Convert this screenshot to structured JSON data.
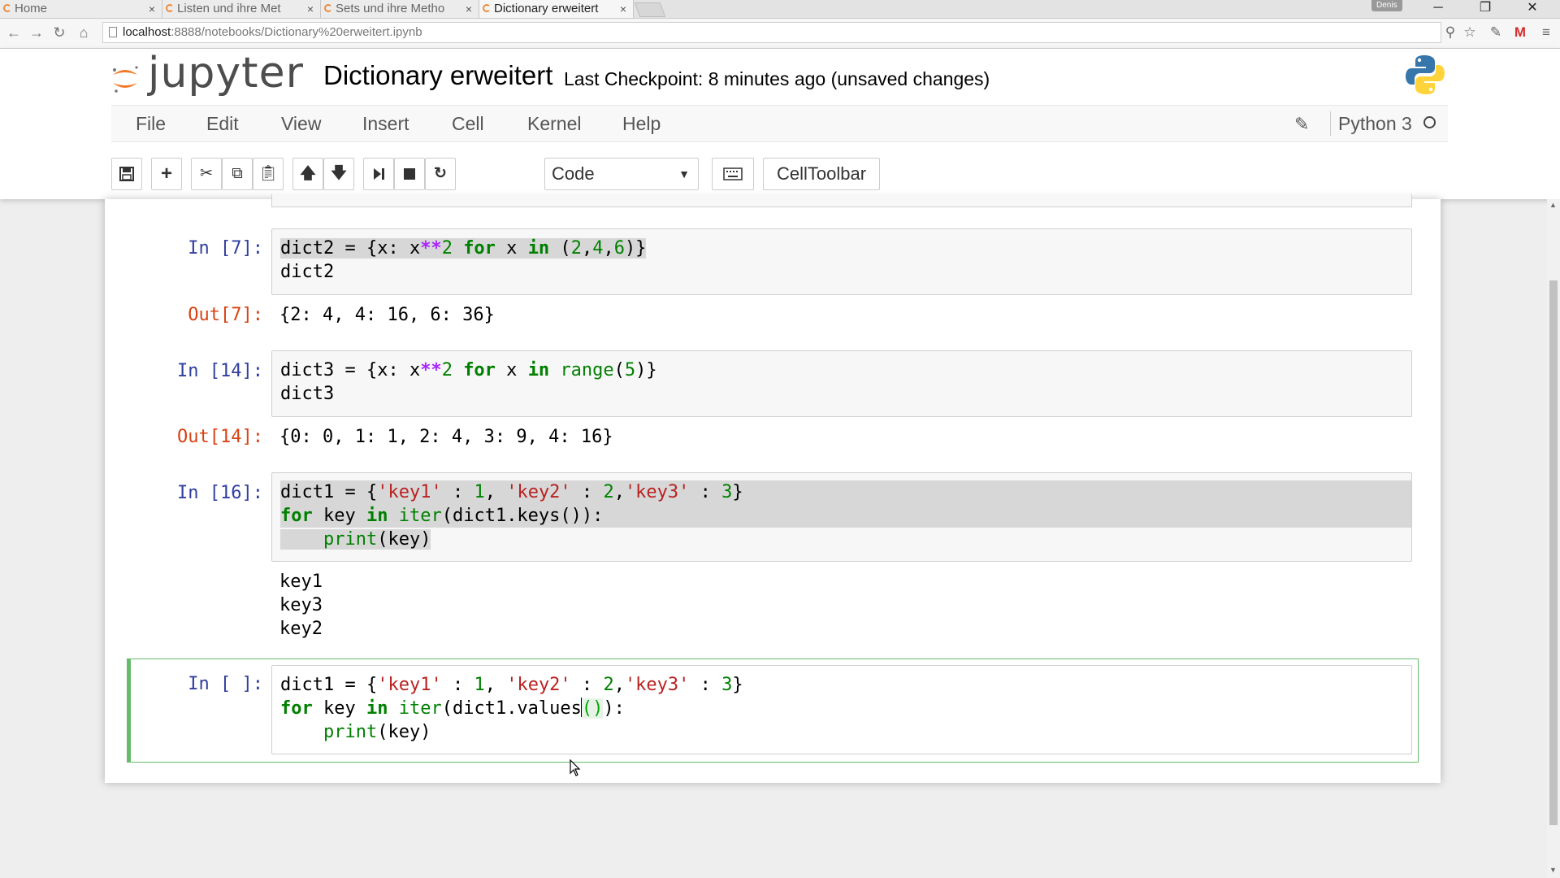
{
  "browser": {
    "tabs": [
      {
        "label": "Home",
        "close": "×"
      },
      {
        "label": "Listen und ihre Met",
        "close": "×"
      },
      {
        "label": "Sets und ihre Metho",
        "close": "×"
      },
      {
        "label": "Dictionary erweitert",
        "close": "×"
      }
    ],
    "user_badge": "Denis",
    "window_controls": {
      "minimize": "─",
      "restore": "❐",
      "close": "✕"
    },
    "url_host": "localhost",
    "url_path": ":8888/notebooks/Dictionary%20erweitert.ipynb"
  },
  "jupyter": {
    "logo_text": "jupyter",
    "notebook_title": "Dictionary erweitert",
    "checkpoint": "Last Checkpoint: 8 minutes ago (unsaved changes)",
    "menu": [
      "File",
      "Edit",
      "View",
      "Insert",
      "Cell",
      "Kernel",
      "Help"
    ],
    "kernel_name": "Python 3",
    "cell_type": "Code",
    "celltoolbar_label": "CellToolbar"
  },
  "cells": [
    {
      "in_prompt": "In [7]:",
      "out_prompt": "Out[7]:",
      "output": "{2: 4, 4: 16, 6: 36}"
    },
    {
      "in_prompt": "In [14]:",
      "out_prompt": "Out[14]:",
      "output": "{0: 0, 1: 1, 2: 4, 3: 9, 4: 16}"
    },
    {
      "in_prompt": "In [16]:",
      "output_lines": [
        "key1",
        "key3",
        "key2"
      ]
    },
    {
      "in_prompt": "In [ ]:"
    }
  ]
}
